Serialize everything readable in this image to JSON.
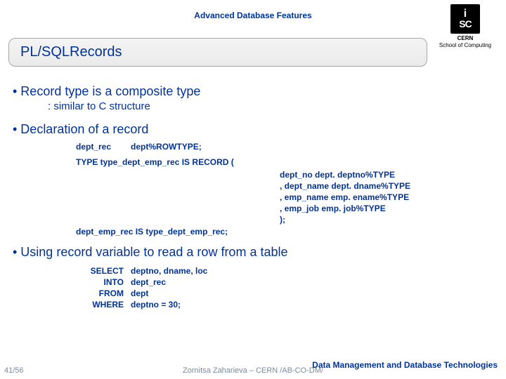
{
  "header": {
    "label": "Advanced Database Features",
    "title": "PL/SQLRecords",
    "logo": {
      "line1": "i",
      "line2": "SC",
      "brand1": "CERN",
      "brand2": "School of Computing"
    }
  },
  "bullets": {
    "b1": "•  Record type is a composite type",
    "b1_sub": ": similar to C structure",
    "b2": "•  Declaration of a record",
    "b3": "•  Using record variable to read a row from a table"
  },
  "code": {
    "rowtype": {
      "var": "dept_rec",
      "type": "dept%ROWTYPE;"
    },
    "typedef": "TYPE type_dept_emp_rec   IS RECORD (",
    "fields": {
      "f1": "  dept_no       dept. deptno%TYPE",
      "f2": ", dept_name dept. dname%TYPE",
      "f3": ", emp_name  emp. ename%TYPE",
      "f4": ", emp_job      emp. job%TYPE",
      "close": ");"
    },
    "typedvar": "dept_emp_rec  IS type_dept_emp_rec;",
    "sql": {
      "select": {
        "kw": "SELECT",
        "args": "deptno, dname, loc"
      },
      "into": {
        "kw": "INTO",
        "args": "dept_rec"
      },
      "from": {
        "kw": "FROM",
        "args": "dept"
      },
      "where": {
        "kw": "WHERE",
        "args": "deptno = 30;"
      }
    }
  },
  "footer": {
    "page": "41/56",
    "author": "Zornitsa Zaharieva – CERN /AB-CO-DM/",
    "right1": "Data Management and Database Technologies"
  }
}
